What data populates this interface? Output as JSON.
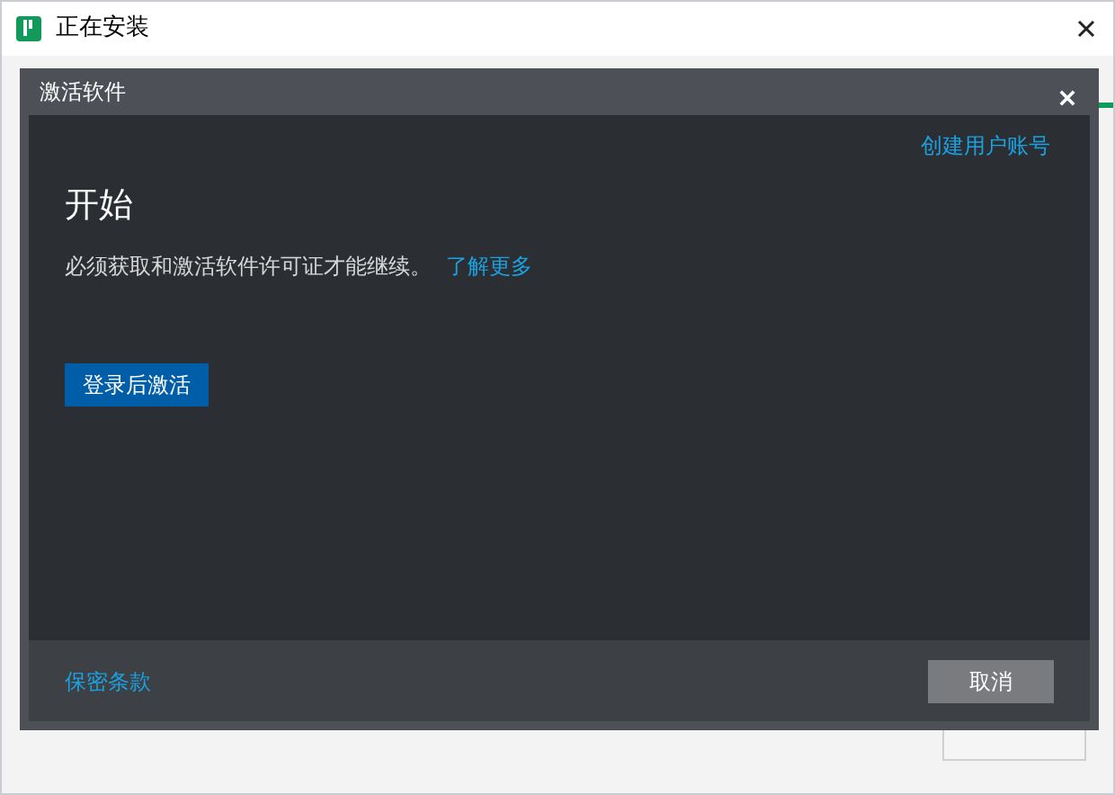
{
  "window": {
    "title": "正在安装"
  },
  "dialog": {
    "title": "激活软件",
    "create_account_link": "创建用户账号",
    "heading": "开始",
    "message": "必须获取和激活软件许可证才能继续。",
    "learn_more_link": "了解更多",
    "activate_button": "登录后激活",
    "privacy_link": "保密条款",
    "cancel_button": "取消"
  }
}
